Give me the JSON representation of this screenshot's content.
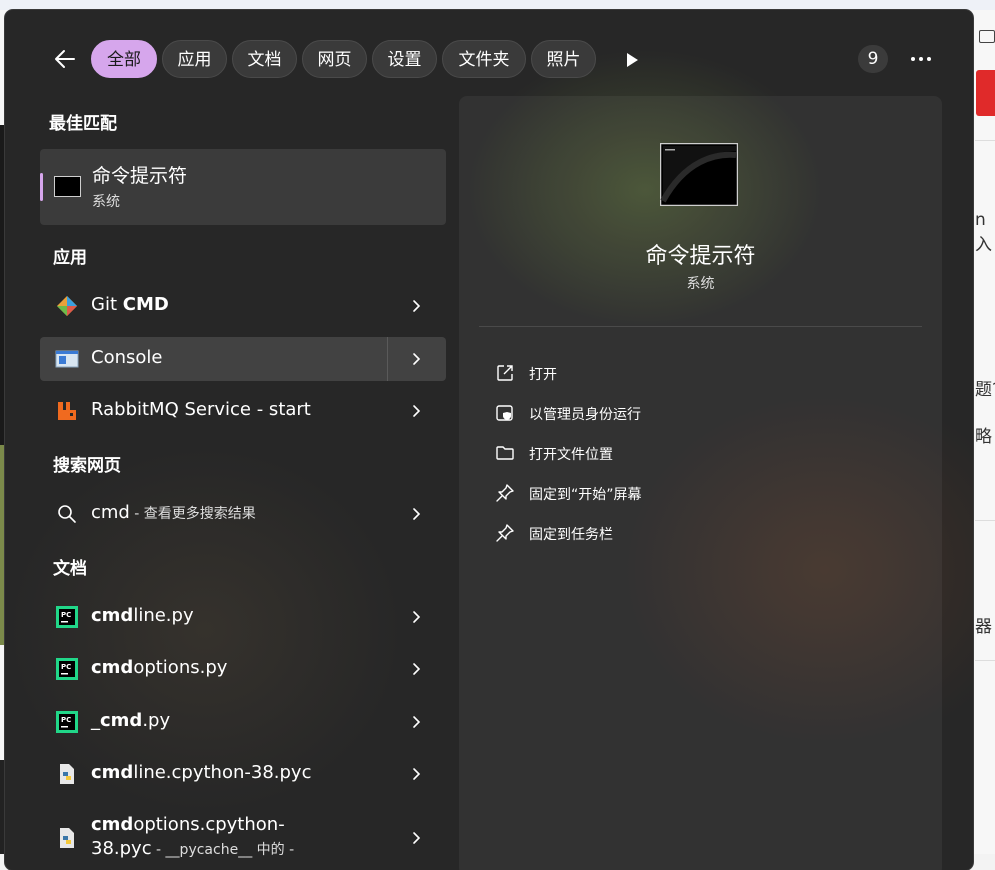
{
  "filters": {
    "chips": [
      "全部",
      "应用",
      "文档",
      "网页",
      "设置",
      "文件夹",
      "照片"
    ],
    "count": "9"
  },
  "best_match": {
    "section": "最佳匹配",
    "title": "命令提示符",
    "subtitle": "系统"
  },
  "apps": {
    "section": "应用",
    "items": [
      {
        "pre": "Git ",
        "bold": "CMD",
        "post": ""
      },
      {
        "pre": "Console",
        "bold": "",
        "post": ""
      },
      {
        "pre": "RabbitMQ Service - start",
        "bold": "",
        "post": ""
      }
    ]
  },
  "web": {
    "section": "搜索网页",
    "query": "cmd",
    "suffix": " - 查看更多搜索结果"
  },
  "docs": {
    "section": "文档",
    "items": [
      {
        "bold": "cmd",
        "post": "line.py"
      },
      {
        "bold": "cmd",
        "post": "options.py"
      },
      {
        "pre": "_",
        "bold": "cmd",
        "post": ".py"
      },
      {
        "bold": "cmd",
        "post": "line.cpython-38.pyc"
      },
      {
        "bold": "cmd",
        "post": "options.cpython-",
        "line2": "38.pyc",
        "line2_sub": " - __pycache__ 中的 -"
      }
    ]
  },
  "preview": {
    "title": "命令提示符",
    "subtitle": "系统",
    "actions": [
      "打开",
      "以管理员身份运行",
      "打开文件位置",
      "固定到“开始”屏幕",
      "固定到任务栏"
    ]
  },
  "background": {
    "texts": [
      "n 入",
      "题?",
      "略",
      "器"
    ]
  },
  "colors": {
    "accent": "#d6a6ec",
    "panel": "#272727"
  }
}
